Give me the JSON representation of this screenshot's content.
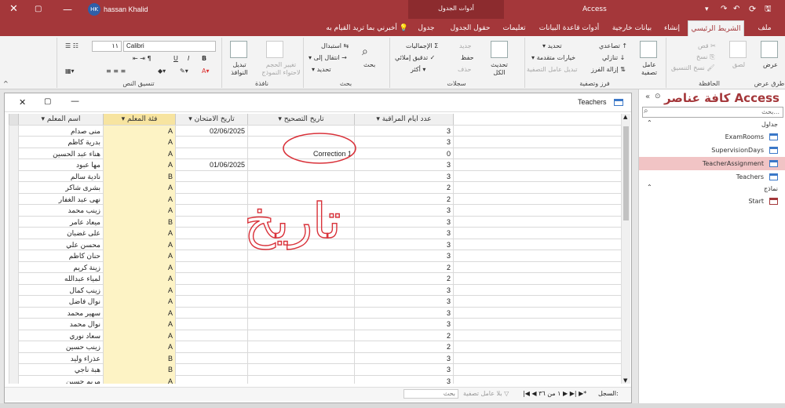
{
  "titlebar": {
    "user": "hassan Khalid",
    "initials": "HK",
    "app": "Access",
    "context_label": "أدوات الجدول"
  },
  "tabs": [
    "ملف",
    "الشريط الرئيسي",
    "إنشاء",
    "بيانات خارجية",
    "أدوات قاعدة البيانات",
    "تعليمات",
    "حقول الجدول",
    "جدول"
  ],
  "tell_me": "أخبرني بما تريد القيام به",
  "ribbon": {
    "views": {
      "view": "عرض",
      "group": "طرق عرض"
    },
    "clipboard": {
      "paste": "لصق",
      "cut": "قص",
      "copy": "نسخ",
      "format_painter": "نسخ التنسيق",
      "group": "الحافظة"
    },
    "sort": {
      "ascending": "تصاعدي",
      "descending": "تنازلي",
      "remove_sort": "إزالة الفرز",
      "filter": "عامل تصفية",
      "selection": "تحديد",
      "advanced": "خيارات متقدمة",
      "toggle": "تبديل عامل التصفية",
      "group": "فرز وتصفية"
    },
    "records": {
      "refresh": "تحديث الكل",
      "new": "جديد",
      "save": "حفظ",
      "delete": "حذف",
      "totals": "الإجماليات",
      "spelling": "تدقيق إملائي",
      "more": "أكثر",
      "group": "سجلات"
    },
    "find": {
      "find": "بحث",
      "replace": "استبدال",
      "goto": "انتقال إلى",
      "select": "تحديد",
      "group": "بحث"
    },
    "window": {
      "size": "تغيير الحجم لاحتواء النموذج",
      "switch": "تبديل النوافذ",
      "group": "نافذة"
    },
    "text": {
      "font": "Calibri",
      "size": "١١",
      "group": "تنسيق النص",
      "bold": "B",
      "italic": "I",
      "underline": "U"
    }
  },
  "nav": {
    "title": "كافة عناصر Access",
    "search_placeholder": "بحث...",
    "sections": [
      {
        "label": "جداول",
        "items": [
          "ExamRooms",
          "SupervisionDays",
          "TeacherAssignment",
          "Teachers"
        ]
      },
      {
        "label": "نماذج",
        "items": [
          "Start"
        ]
      }
    ],
    "selected": "TeacherAssignment"
  },
  "document": {
    "tab": "Teachers",
    "columns": [
      "اسم المعلم",
      "فئة المعلم",
      "تاريخ الامتحان",
      "تاريخ التصحيح",
      "عدد ايام المراقبة"
    ],
    "rows": [
      [
        "منى صدام",
        "A",
        "02/06/2025",
        "",
        "3"
      ],
      [
        "بدرية كاظم",
        "A",
        "",
        "",
        "3"
      ],
      [
        "هناء عبد الحسين",
        "A",
        "",
        "Correction 1",
        "0"
      ],
      [
        "مها عبود",
        "A",
        "01/06/2025",
        "",
        "3"
      ],
      [
        "نادية سالم",
        "B",
        "",
        "",
        "3"
      ],
      [
        "بشرى شاكر",
        "A",
        "",
        "",
        "2"
      ],
      [
        "نهى عبد الغفار",
        "A",
        "",
        "",
        "2"
      ],
      [
        "زينب محمد",
        "A",
        "",
        "",
        "3"
      ],
      [
        "ميعاد عامر",
        "B",
        "",
        "",
        "3"
      ],
      [
        "على غضبان",
        "A",
        "",
        "",
        "3"
      ],
      [
        "محسن علي",
        "A",
        "",
        "",
        "3"
      ],
      [
        "حنان كاظم",
        "A",
        "",
        "",
        "3"
      ],
      [
        "زينة كريم",
        "A",
        "",
        "",
        "2"
      ],
      [
        "لمياء عبدالله",
        "A",
        "",
        "",
        "2"
      ],
      [
        "زينب كمال",
        "A",
        "",
        "",
        "3"
      ],
      [
        "نوال فاضل",
        "A",
        "",
        "",
        "3"
      ],
      [
        "سهير محمد",
        "A",
        "",
        "",
        "3"
      ],
      [
        "نوال محمد",
        "A",
        "",
        "",
        "3"
      ],
      [
        "سعاد نوري",
        "A",
        "",
        "",
        "2"
      ],
      [
        "زينب حسين",
        "A",
        "",
        "",
        "2"
      ],
      [
        "عذراء وليد",
        "B",
        "",
        "",
        "3"
      ],
      [
        "هبة ناجي",
        "B",
        "",
        "",
        "3"
      ],
      [
        "مريم حسين",
        "A",
        "",
        "",
        "3"
      ]
    ],
    "annotation": "تاريخ",
    "status": {
      "record_label": "السجل:",
      "record_value": "١ من ٣٦",
      "nofilter": "بلا عامل تصفية",
      "search": "بحث"
    }
  },
  "colors": {
    "accent": "#a4373a",
    "selected_nav": "#f1c4c5",
    "highlight_col": "#fdf3c5",
    "ink": "#d9323a"
  }
}
